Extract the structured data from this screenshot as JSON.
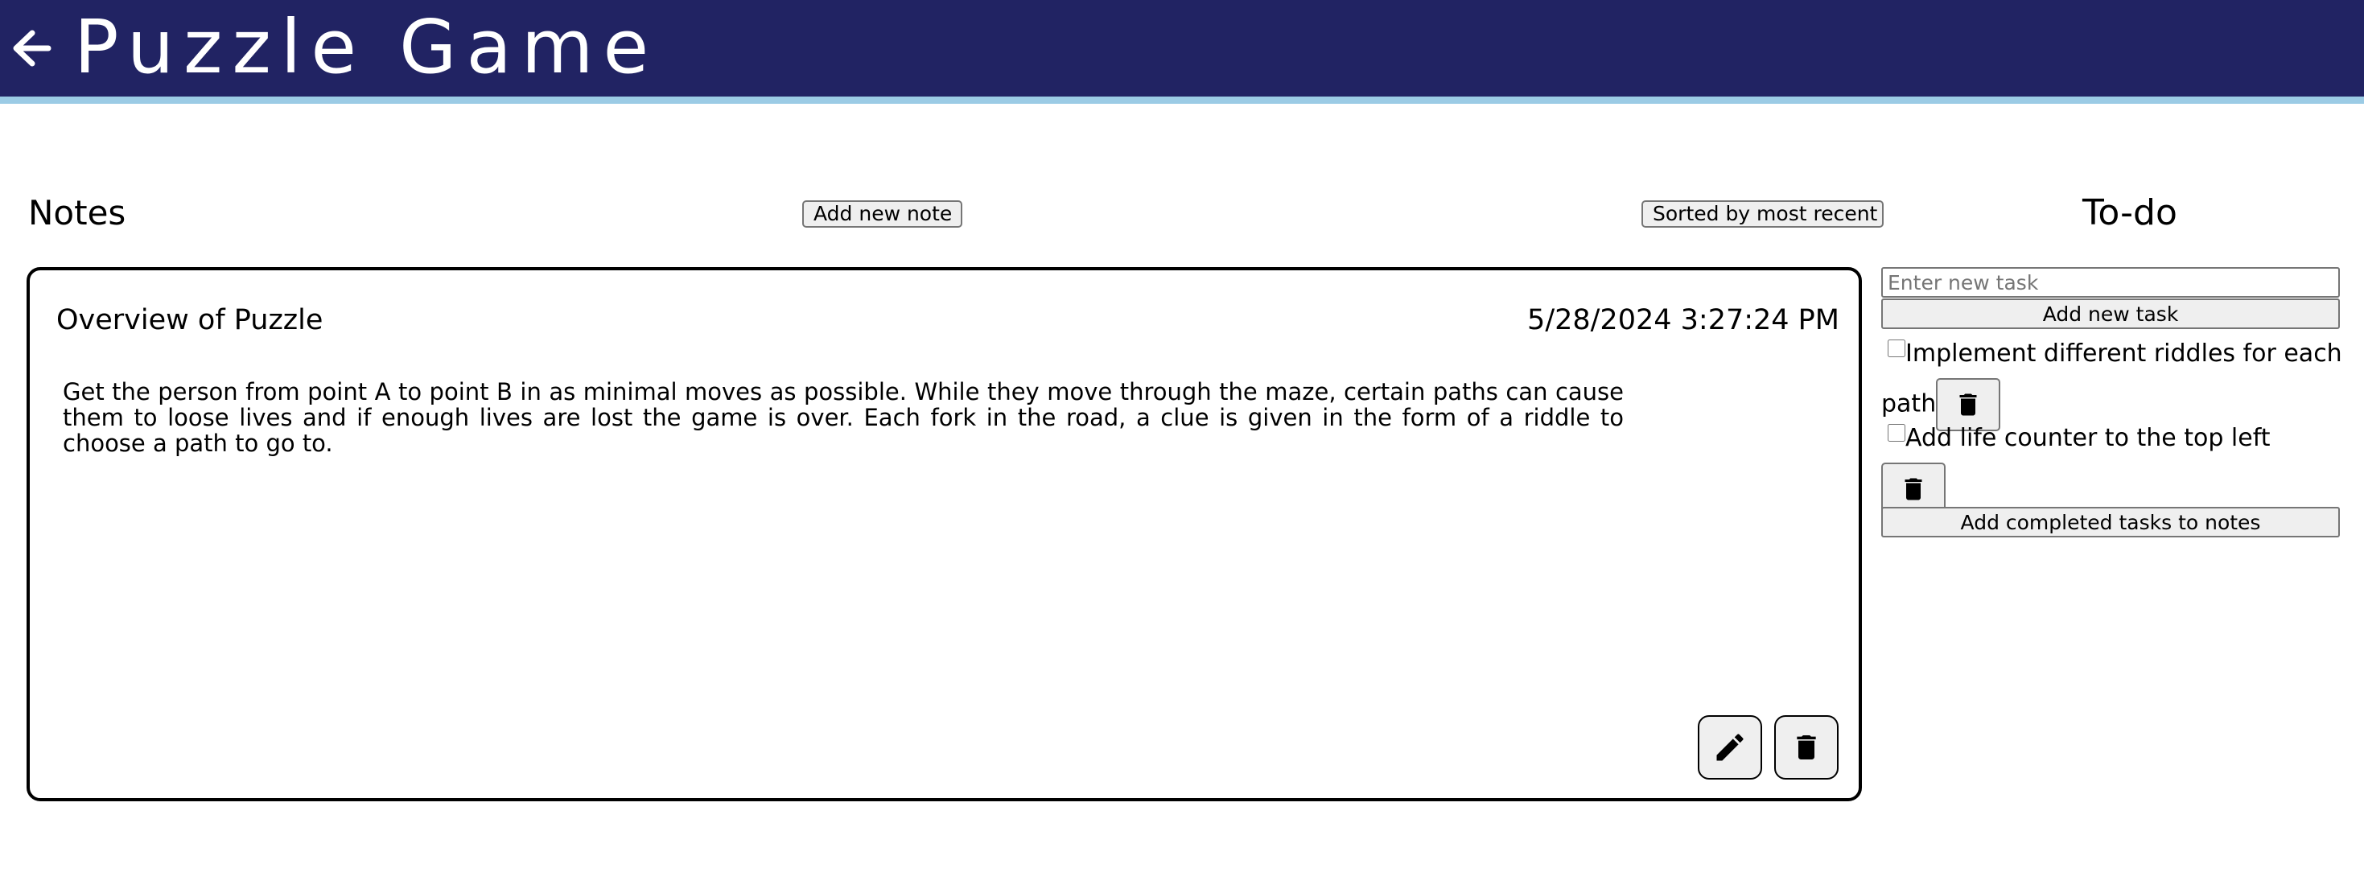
{
  "header": {
    "title": "Puzzle Game",
    "back_icon": "arrow-left-icon",
    "background_color": "#212363",
    "accent_color": "#9bcbe5"
  },
  "notes": {
    "heading": "Notes",
    "add_button_label": "Add new note",
    "sort_button_label": "Sorted by most recent",
    "items": [
      {
        "title": "Overview of Puzzle",
        "date": "5/28/2024 3:27:24 PM",
        "body": "Get the person from point A to point B in as minimal moves as possible. While they move through the maze, certain paths can cause them to loose lives and if enough lives are lost the game is over. Each fork in the road, a clue is given in the form of a riddle to choose a path to go to.",
        "edit_icon": "pencil-icon",
        "delete_icon": "trash-icon"
      }
    ]
  },
  "todo": {
    "heading": "To-do",
    "input_placeholder": "Enter new task",
    "input_value": "",
    "add_button_label": "Add new task",
    "tasks": [
      {
        "text": "Implement different riddles for each path",
        "checked": false,
        "delete_icon": "trash-icon"
      },
      {
        "text": "Add life counter to the top left",
        "checked": false,
        "delete_icon": "trash-icon"
      }
    ],
    "add_completed_label": "Add completed tasks to notes"
  }
}
